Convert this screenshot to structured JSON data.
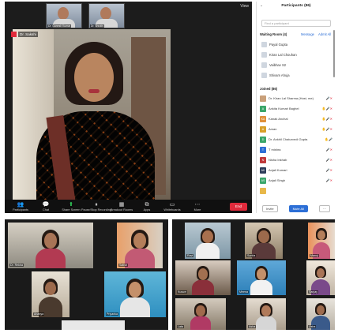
{
  "meeting": {
    "thumbnails": [
      {
        "label": "Dr. Ganesh Kumar"
      },
      {
        "label": "Dr. Shruthi"
      }
    ],
    "view_label": "View",
    "speaker_name": "Dr. Sakshi"
  },
  "toolbar": {
    "items": [
      {
        "label": "Participants",
        "icon": "participants-icon",
        "glyph": "👥"
      },
      {
        "label": "Chat",
        "icon": "chat-icon",
        "glyph": "💬"
      },
      {
        "label": "Share Screen",
        "icon": "share-screen-icon",
        "glyph": "⬆"
      },
      {
        "label": "Pause/Stop Recording",
        "icon": "record-icon",
        "glyph": "⏸"
      },
      {
        "label": "Breakout Rooms",
        "icon": "breakout-rooms-icon",
        "glyph": "▦"
      },
      {
        "label": "Apps",
        "icon": "apps-icon",
        "glyph": "⧉"
      },
      {
        "label": "Whiteboards",
        "icon": "whiteboard-icon",
        "glyph": "▭"
      },
      {
        "label": "More",
        "icon": "more-icon",
        "glyph": "⋯"
      }
    ],
    "end_label": "End"
  },
  "participants": {
    "title": "Participants (86)",
    "search_placeholder": "Find a participant",
    "waiting_head": "Waiting Room (4)",
    "message_label": "Message",
    "admit_all_label": "Admit All",
    "waiting": [
      {
        "name": "Payal Gupta"
      },
      {
        "name": "Kiran Lal Chouhan"
      },
      {
        "name": "Vaibhav S2"
      },
      {
        "name": "Shivam Ahuja"
      }
    ],
    "joined_head": "Joined (86)",
    "joined": [
      {
        "initials": "",
        "name": "Dr. Kiran Lal Sharma (Host, me)",
        "color": "#c9a07a",
        "icons": "🎤✕"
      },
      {
        "initials": "A",
        "name": "Ankita Kumari Baghel",
        "color": "#3aa66a",
        "icons": "✋🎤✕"
      },
      {
        "initials": "KA",
        "name": "Kanak Anchal",
        "color": "#e0903a",
        "icons": "✋🎤✕"
      },
      {
        "initials": "A",
        "name": "Aman",
        "color": "#d9a02a",
        "icons": "✋🎤✕"
      },
      {
        "initials": "D",
        "name": "Dr. Ankhil Chaturvedi Gupta",
        "color": "#3aa66a",
        "icons": "✋🎤"
      },
      {
        "initials": "T",
        "name": "T mishra",
        "color": "#2d6fd6",
        "icons": "🎤✕"
      },
      {
        "initials": "N",
        "name": "Nisha Inkhab",
        "color": "#c0393b",
        "icons": "🎤✕"
      },
      {
        "initials": "AK",
        "name": "Anjali Kumari",
        "color": "#2d3d5a",
        "icons": "🎤✕"
      },
      {
        "initials": "AS",
        "name": "Anjali Singh",
        "color": "#3aa66a",
        "icons": "🎤✕"
      },
      {
        "initials": "",
        "name": "",
        "color": "#e8b84a",
        "icons": ""
      }
    ],
    "footer_buttons": [
      {
        "label": "Invite"
      },
      {
        "label": "Mute All"
      },
      {
        "label": "···"
      }
    ]
  },
  "gallery_left": {
    "tiles": [
      {
        "label": "Dr. Rekha",
        "active": true
      },
      {
        "label": "Satish"
      },
      {
        "label": "Ananya"
      },
      {
        "label": "Priyanka"
      },
      {
        "label": ""
      }
    ]
  },
  "gallery_right": {
    "tiles": [
      {
        "label": "Ravi",
        "active": true
      },
      {
        "label": "Sunita"
      },
      {
        "label": "Manoj"
      },
      {
        "label": "Kusum"
      },
      {
        "label": "Meena"
      },
      {
        "label": "Sanjay"
      },
      {
        "label": "Lata"
      },
      {
        "label": "Asha"
      },
      {
        "label": "Usha"
      }
    ]
  }
}
